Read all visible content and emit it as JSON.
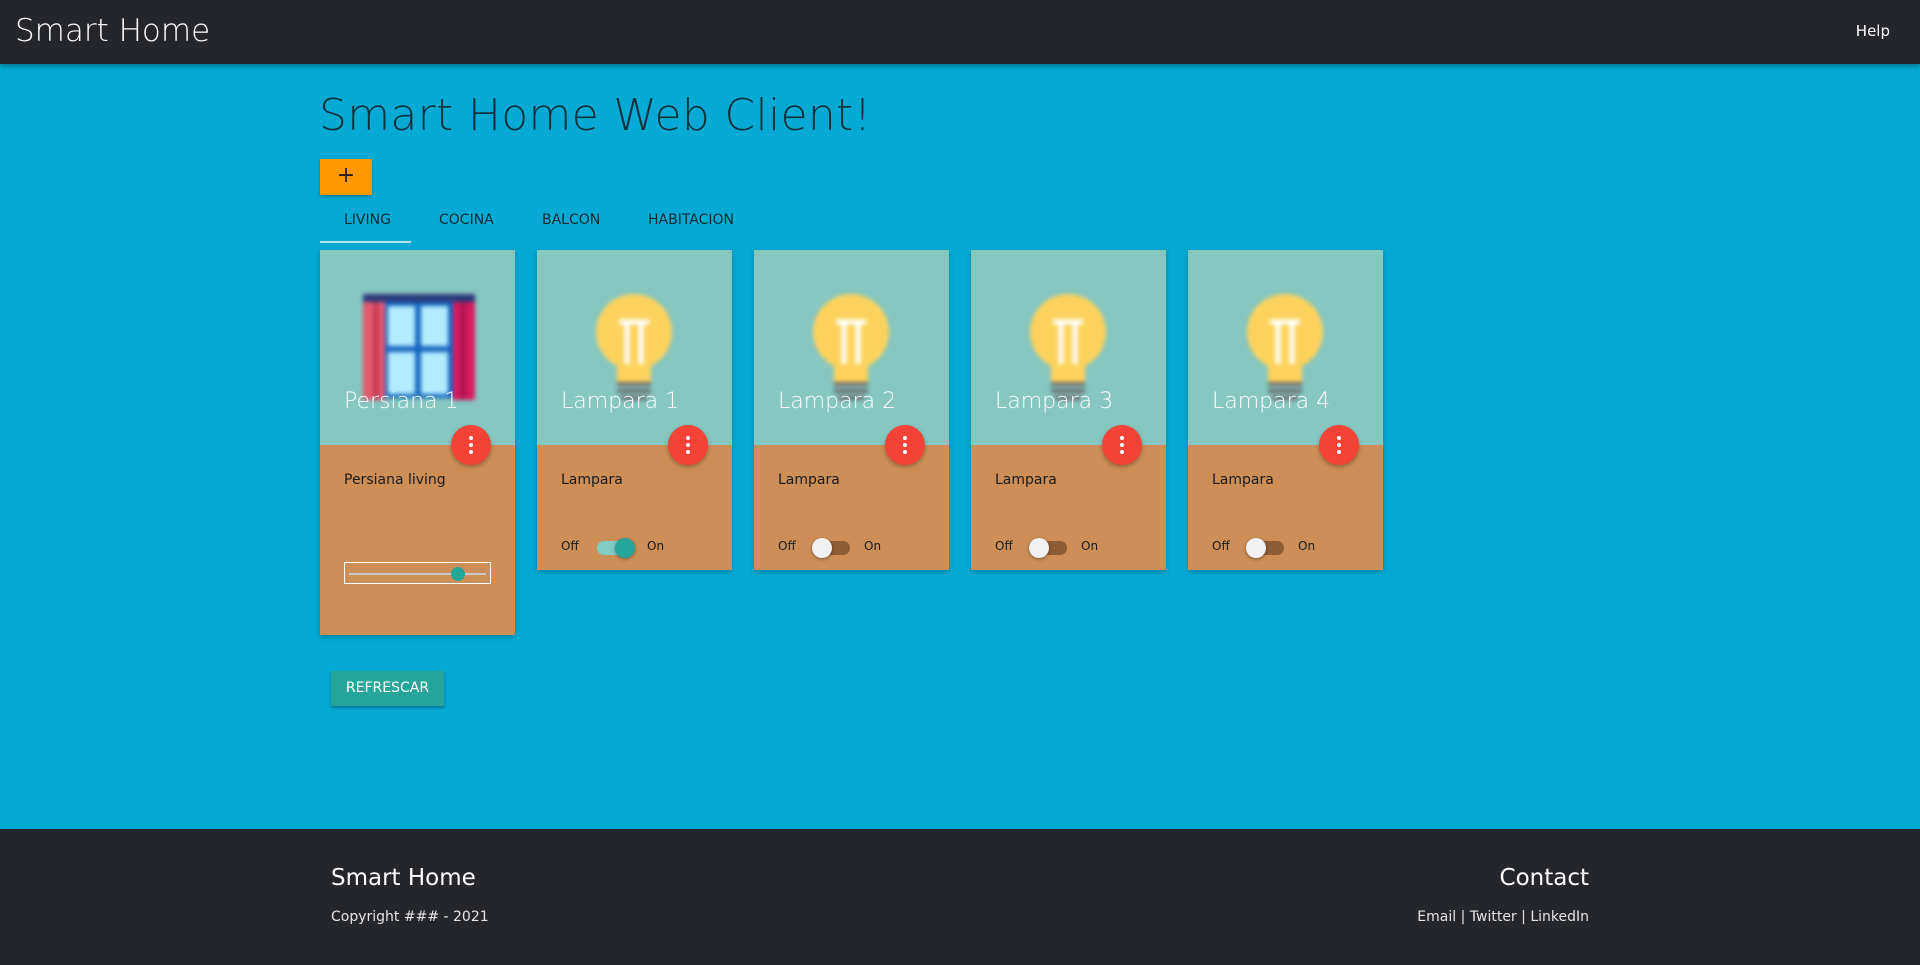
{
  "header": {
    "brand": "Smart Home",
    "help_label": "Help"
  },
  "main": {
    "title": "Smart Home Web Client!",
    "add_label": "+",
    "tabs": [
      {
        "label": "LIVING",
        "active": true
      },
      {
        "label": "COCINA",
        "active": false
      },
      {
        "label": "BALCON",
        "active": false
      },
      {
        "label": "HABITACION",
        "active": false
      }
    ],
    "refresh_label": "REFRESCAR"
  },
  "devices": [
    {
      "name": "Persiana 1",
      "description": "Persiana living",
      "type": "blind",
      "icon": "window-blinds-icon",
      "level": 0.8
    },
    {
      "name": "Lampara 1",
      "description": "Lampara",
      "type": "lamp",
      "icon": "lightbulb-icon",
      "off_label": "Off",
      "on_label": "On",
      "state": true
    },
    {
      "name": "Lampara 2",
      "description": "Lampara",
      "type": "lamp",
      "icon": "lightbulb-icon",
      "off_label": "Off",
      "on_label": "On",
      "state": false
    },
    {
      "name": "Lampara 3",
      "description": "Lampara",
      "type": "lamp",
      "icon": "lightbulb-icon",
      "off_label": "Off",
      "on_label": "On",
      "state": false
    },
    {
      "name": "Lampara 4",
      "description": "Lampara",
      "type": "lamp",
      "icon": "lightbulb-icon",
      "off_label": "Off",
      "on_label": "On",
      "state": false
    }
  ],
  "footer": {
    "brand": "Smart Home",
    "copyright": "Copyright ### - 2021",
    "contact_title": "Contact",
    "links": [
      "Email",
      "Twitter",
      "LinkedIn"
    ],
    "links_separator": " | "
  },
  "colors": {
    "page_background": "#04aad4",
    "navbar": "#25262b",
    "add_button": "#ff9800",
    "card_top": "#86c7c0",
    "card_bottom": "#cd8e57",
    "fab": "#f44336",
    "accent": "#26a69a"
  }
}
